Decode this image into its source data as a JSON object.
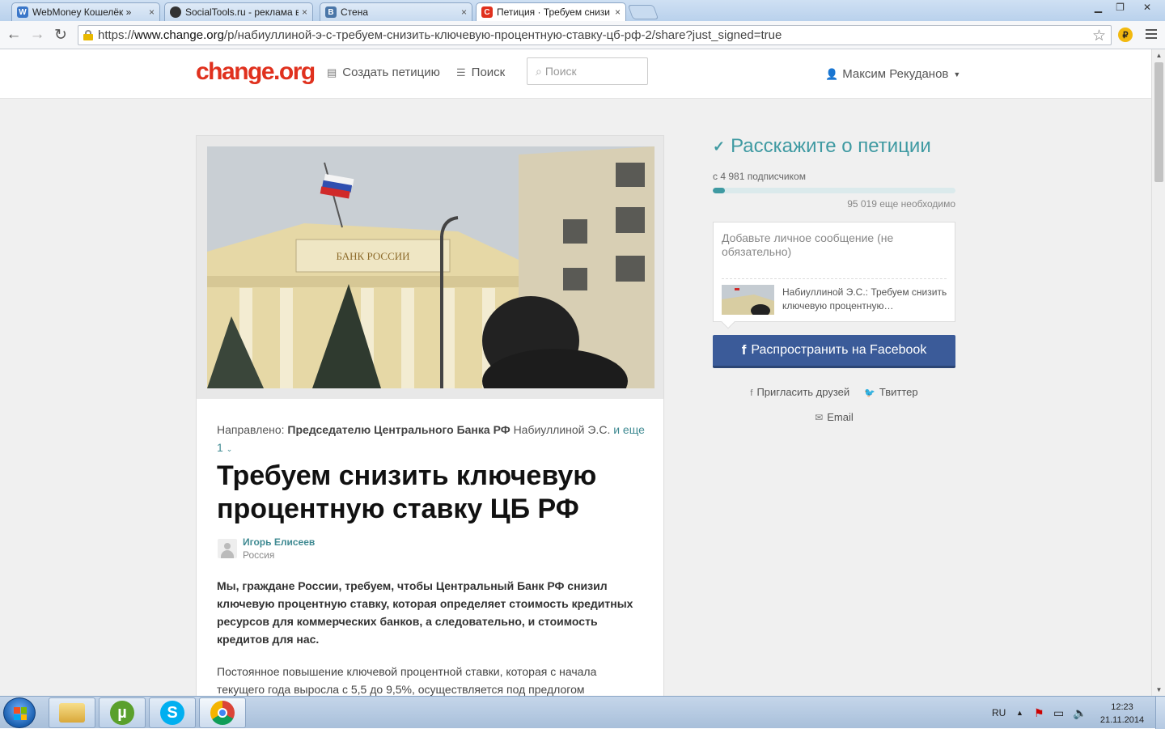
{
  "browser": {
    "tabs": [
      {
        "label": "WebMoney Кошелёк »",
        "favicon": "webmoney-icon",
        "color": "#3b77c9"
      },
      {
        "label": "SocialTools.ru - реклама в",
        "favicon": "socialtools-icon",
        "color": "#333333"
      },
      {
        "label": "Стена",
        "favicon": "vk-icon",
        "color": "#4a76a8"
      },
      {
        "label": "Петиция · Требуем снизи",
        "favicon": "change-org-icon",
        "color": "#e0311e",
        "active": true
      }
    ],
    "tab_close": "×",
    "url_prefix": "https://",
    "url_host": "www.change.org",
    "url_path": "/p/набиуллиной-э-с-требуем-снизить-ключевую-процентную-ставку-цб-рф-2/share?just_signed=true",
    "extension_badge": "₽"
  },
  "header": {
    "logo": "change.org",
    "create_link": "Создать петицию",
    "browse_link": "Поиск",
    "search_placeholder": "Поиск",
    "user_name": "Максим Рекуданов"
  },
  "petition": {
    "directed_prefix": "Направлено:",
    "directed_target": "Председателю Центрального Банка РФ",
    "directed_person": "Набиуллиной Э.С.",
    "directed_more": "и еще 1",
    "title": "Требуем снизить ключевую процентную ставку ЦБ РФ",
    "author_name": "Игорь Елисеев",
    "author_location": "Россия",
    "lead": "Мы, граждане России, требуем, чтобы Центральный Банк РФ снизил ключевую процентную ставку, которая определяет стоимость кредитных ресурсов для коммерческих банков, а следовательно, и стоимость кредитов для нас.",
    "body": "Постоянное повышение ключевой процентной ставки, которая с начала текущего года выросла с 5,5 до 9,5%, осуществляется под предлогом",
    "photo_sign": "БАНК РОССИИ"
  },
  "share": {
    "title": "Расскажите о петиции",
    "signature_count": "с 4 981 подписчиком",
    "progress_fraction": 0.05,
    "needed": "95 019 еще необходимо",
    "message_placeholder": "Добавьте личное сообщение (не обязательно)",
    "preview_text": "Набиуллиной Э.С.: Требуем снизить ключевую процентную…",
    "facebook_button": "Распространить на Facebook",
    "invite_link": "Пригласить друзей",
    "twitter_link": "Твиттер",
    "email_link": "Email",
    "accent_color": "#3f9aa2",
    "facebook_color": "#3b5b99"
  },
  "taskbar": {
    "language": "RU",
    "time": "12:23",
    "date": "21.11.2014"
  }
}
